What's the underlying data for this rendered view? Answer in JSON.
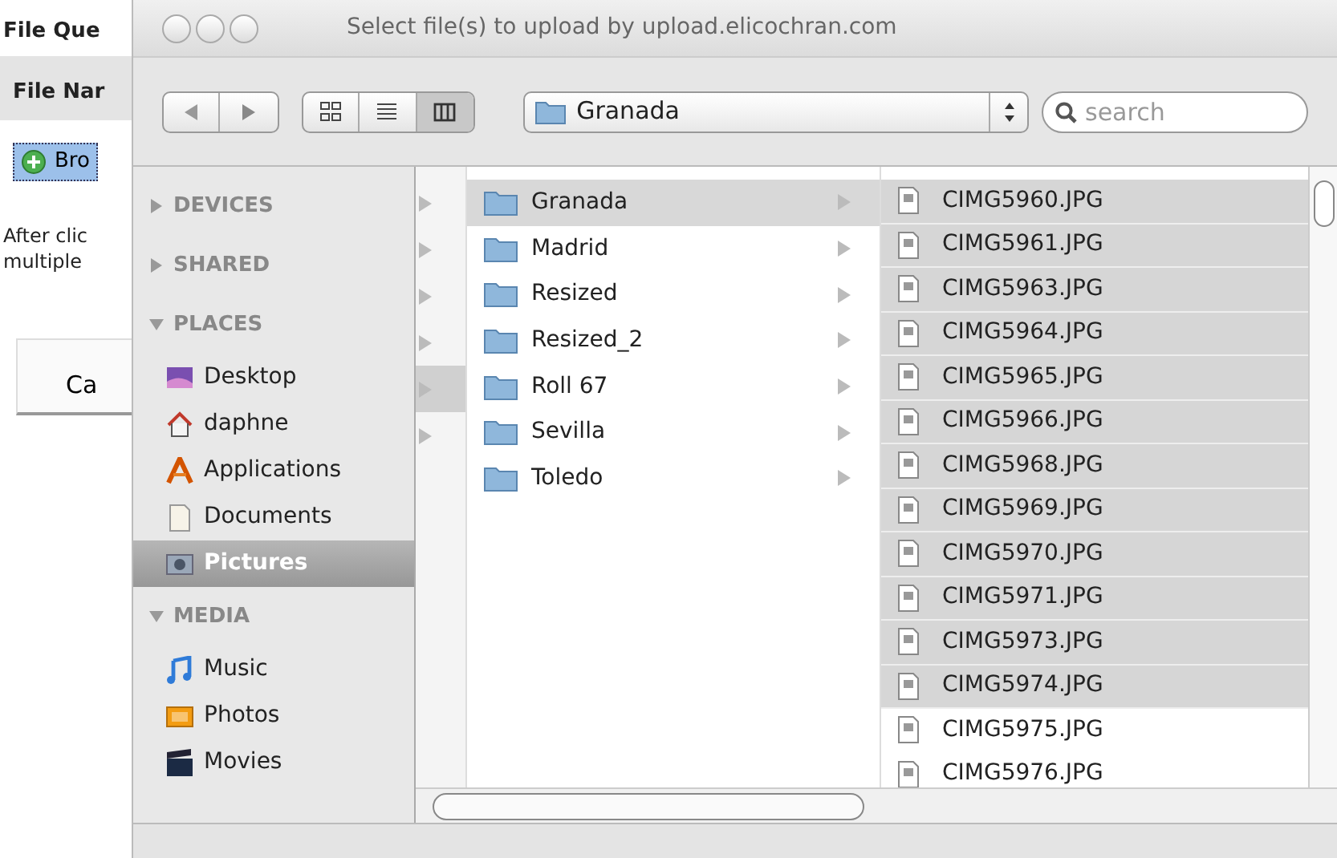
{
  "page": {
    "heading": "File Que",
    "column_header": "File Nar",
    "browse_button": "Bro",
    "instructions": [
      "After clic",
      "multiple"
    ],
    "cancel_button": "Ca"
  },
  "dialog": {
    "title": "Select file(s) to upload by upload.elicochran.com",
    "view_modes": [
      {
        "kind": "icons",
        "selected": false
      },
      {
        "kind": "list",
        "selected": false
      },
      {
        "kind": "columns",
        "selected": true
      }
    ],
    "location": "Granada",
    "search": {
      "placeholder": "search"
    },
    "sidebar": [
      {
        "label": "DEVICES",
        "expanded": false
      },
      {
        "label": "SHARED",
        "expanded": false
      },
      {
        "label": "PLACES",
        "expanded": true,
        "children": [
          {
            "kind": "desktop",
            "label": "Desktop",
            "selected": false
          },
          {
            "kind": "home",
            "label": "daphne",
            "selected": false
          },
          {
            "kind": "applications",
            "label": "Applications",
            "selected": false
          },
          {
            "kind": "documents",
            "label": "Documents",
            "selected": false
          },
          {
            "kind": "pictures",
            "label": "Pictures",
            "selected": true
          }
        ]
      },
      {
        "label": "MEDIA",
        "expanded": true,
        "children": [
          {
            "kind": "music",
            "label": "Music",
            "selected": false
          },
          {
            "kind": "photos",
            "label": "Photos",
            "selected": false
          },
          {
            "kind": "movies",
            "label": "Movies",
            "selected": false
          }
        ]
      }
    ],
    "previous_column": [
      {
        "selected": false
      },
      {
        "selected": false
      },
      {
        "selected": false
      },
      {
        "selected": false
      },
      {
        "selected": true
      },
      {
        "selected": false
      }
    ],
    "folders": [
      {
        "name": "Granada",
        "selected": true
      },
      {
        "name": "Madrid",
        "selected": false
      },
      {
        "name": "Resized",
        "selected": false
      },
      {
        "name": "Resized_2",
        "selected": false
      },
      {
        "name": "Roll 67",
        "selected": false
      },
      {
        "name": "Sevilla",
        "selected": false
      },
      {
        "name": "Toledo",
        "selected": false
      }
    ],
    "files": [
      {
        "name": "CIMG5960.JPG",
        "selected": true
      },
      {
        "name": "CIMG5961.JPG",
        "selected": true
      },
      {
        "name": "CIMG5963.JPG",
        "selected": true
      },
      {
        "name": "CIMG5964.JPG",
        "selected": true
      },
      {
        "name": "CIMG5965.JPG",
        "selected": true
      },
      {
        "name": "CIMG5966.JPG",
        "selected": true
      },
      {
        "name": "CIMG5968.JPG",
        "selected": true
      },
      {
        "name": "CIMG5969.JPG",
        "selected": true
      },
      {
        "name": "CIMG5970.JPG",
        "selected": true
      },
      {
        "name": "CIMG5971.JPG",
        "selected": true
      },
      {
        "name": "CIMG5973.JPG",
        "selected": true
      },
      {
        "name": "CIMG5974.JPG",
        "selected": true
      },
      {
        "name": "CIMG5975.JPG",
        "selected": false
      },
      {
        "name": "CIMG5976.JPG",
        "selected": false
      }
    ]
  }
}
